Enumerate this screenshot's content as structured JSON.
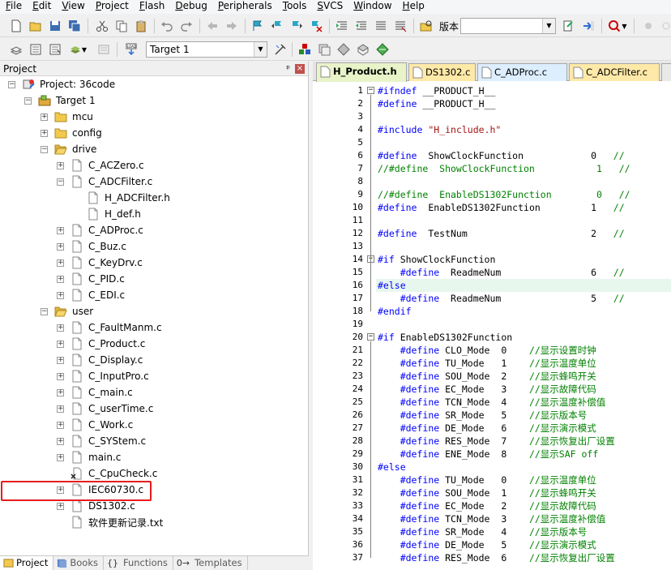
{
  "menu": [
    "File",
    "Edit",
    "View",
    "Project",
    "Flash",
    "Debug",
    "Peripherals",
    "Tools",
    "SVCS",
    "Window",
    "Help"
  ],
  "menu_underline": [
    "F",
    "E",
    "V",
    "P",
    "F",
    "D",
    "P",
    "T",
    "S",
    "W",
    "H"
  ],
  "toolbar": {
    "version_label": "版本",
    "target": "Target 1"
  },
  "project_panel": {
    "title": "Project",
    "pin": "ᵖ",
    "close": "×",
    "tree": [
      {
        "label": "Project: 36code",
        "depth": 0,
        "expander": "minus",
        "icon": "project-icon"
      },
      {
        "label": "Target 1",
        "depth": 1,
        "expander": "minus",
        "icon": "target-icon"
      },
      {
        "label": "mcu",
        "depth": 2,
        "expander": "plus",
        "icon": "folder-icon"
      },
      {
        "label": "config",
        "depth": 2,
        "expander": "plus",
        "icon": "folder-icon"
      },
      {
        "label": "drive",
        "depth": 2,
        "expander": "minus",
        "icon": "folder-open-icon"
      },
      {
        "label": "C_ACZero.c",
        "depth": 3,
        "expander": "plus",
        "icon": "file-icon"
      },
      {
        "label": "C_ADCFilter.c",
        "depth": 3,
        "expander": "minus",
        "icon": "file-icon"
      },
      {
        "label": "H_ADCFilter.h",
        "depth": 4,
        "expander": "none",
        "icon": "file-icon"
      },
      {
        "label": "H_def.h",
        "depth": 4,
        "expander": "none",
        "icon": "file-icon"
      },
      {
        "label": "C_ADProc.c",
        "depth": 3,
        "expander": "plus",
        "icon": "file-icon"
      },
      {
        "label": "C_Buz.c",
        "depth": 3,
        "expander": "plus",
        "icon": "file-icon"
      },
      {
        "label": "C_KeyDrv.c",
        "depth": 3,
        "expander": "plus",
        "icon": "file-icon"
      },
      {
        "label": "C_PID.c",
        "depth": 3,
        "expander": "plus",
        "icon": "file-icon"
      },
      {
        "label": "C_EDI.c",
        "depth": 3,
        "expander": "plus",
        "icon": "file-icon"
      },
      {
        "label": "user",
        "depth": 2,
        "expander": "minus",
        "icon": "folder-open-icon"
      },
      {
        "label": "C_FaultManm.c",
        "depth": 3,
        "expander": "plus",
        "icon": "file-icon"
      },
      {
        "label": "C_Product.c",
        "depth": 3,
        "expander": "plus",
        "icon": "file-icon"
      },
      {
        "label": "C_Display.c",
        "depth": 3,
        "expander": "plus",
        "icon": "file-icon"
      },
      {
        "label": "C_InputPro.c",
        "depth": 3,
        "expander": "plus",
        "icon": "file-icon"
      },
      {
        "label": "C_main.c",
        "depth": 3,
        "expander": "plus",
        "icon": "file-icon"
      },
      {
        "label": "C_userTime.c",
        "depth": 3,
        "expander": "plus",
        "icon": "file-icon"
      },
      {
        "label": "C_Work.c",
        "depth": 3,
        "expander": "plus",
        "icon": "file-icon"
      },
      {
        "label": "C_SYStem.c",
        "depth": 3,
        "expander": "plus",
        "icon": "file-icon"
      },
      {
        "label": "main.c",
        "depth": 3,
        "expander": "plus",
        "icon": "file-icon"
      },
      {
        "label": "C_CpuCheck.c",
        "depth": 3,
        "expander": "none",
        "icon": "file-excluded-icon"
      },
      {
        "label": "IEC60730.c",
        "depth": 3,
        "expander": "plus",
        "icon": "file-icon"
      },
      {
        "label": "DS1302.c",
        "depth": 3,
        "expander": "plus",
        "icon": "file-icon"
      },
      {
        "label": "软件更新记录.txt",
        "depth": 3,
        "expander": "none",
        "icon": "file-icon"
      }
    ],
    "bottom_tabs": [
      {
        "label": "Project",
        "icon": "project-tab-icon"
      },
      {
        "label": "Books",
        "icon": "books-icon"
      },
      {
        "label": "Functions",
        "icon": "{}"
      },
      {
        "label": "Templates",
        "icon": "0→"
      }
    ]
  },
  "editor": {
    "tabs": [
      "H_Product.h",
      "DS1302.c",
      "C_ADProc.c",
      "C_ADCFilter.c"
    ],
    "active_tab": 0,
    "tab_colors": [
      "#e8f3c8",
      "#ffe9a8",
      "#ddeeff",
      "#ffe9a8"
    ],
    "highlight_line": 16,
    "lines": [
      {
        "n": "1",
        "fold": "minus",
        "t": "#ifndef __PRODUCT_H__"
      },
      {
        "n": "2",
        "fold": "",
        "t": "#define __PRODUCT_H__"
      },
      {
        "n": "3",
        "fold": "",
        "t": ""
      },
      {
        "n": "4",
        "fold": "",
        "t": "#include \"H_include.h\""
      },
      {
        "n": "5",
        "fold": "",
        "t": ""
      },
      {
        "n": "6",
        "fold": "",
        "t": "#define  ShowClockFunction            0   //"
      },
      {
        "n": "7",
        "fold": "",
        "t": "//#define  ShowClockFunction           1   //"
      },
      {
        "n": "8",
        "fold": "",
        "t": ""
      },
      {
        "n": "9",
        "fold": "",
        "t": "//#define  EnableDS1302Function        0   //"
      },
      {
        "n": "10",
        "fold": "",
        "t": "#define  EnableDS1302Function         1   //"
      },
      {
        "n": "11",
        "fold": "",
        "t": ""
      },
      {
        "n": "12",
        "fold": "",
        "t": "#define  TestNum                      2   //"
      },
      {
        "n": "13",
        "fold": "",
        "t": ""
      },
      {
        "n": "14",
        "fold": "minus",
        "t": "#if ShowClockFunction"
      },
      {
        "n": "15",
        "fold": "",
        "t": "    #define  ReadmeNum                6   //"
      },
      {
        "n": "16",
        "fold": "",
        "t": "#else"
      },
      {
        "n": "17",
        "fold": "",
        "t": "    #define  ReadmeNum                5   //"
      },
      {
        "n": "18",
        "fold": "",
        "t": "#endif"
      },
      {
        "n": "19",
        "fold": "",
        "t": ""
      },
      {
        "n": "20",
        "fold": "minus",
        "t": "#if EnableDS1302Function"
      },
      {
        "n": "21",
        "fold": "",
        "t": "    #define CLO_Mode  0    //显示设置时钟"
      },
      {
        "n": "22",
        "fold": "",
        "t": "    #define TU_Mode   1    //显示温度单位"
      },
      {
        "n": "23",
        "fold": "",
        "t": "    #define SOU_Mode  2    //显示蜂鸣开关"
      },
      {
        "n": "24",
        "fold": "",
        "t": "    #define EC_Mode   3    //显示故障代码"
      },
      {
        "n": "25",
        "fold": "",
        "t": "    #define TCN_Mode  4    //显示温度补偿值"
      },
      {
        "n": "26",
        "fold": "",
        "t": "    #define SR_Mode   5    //显示版本号"
      },
      {
        "n": "27",
        "fold": "",
        "t": "    #define DE_Mode   6    //显示演示模式"
      },
      {
        "n": "28",
        "fold": "",
        "t": "    #define RES_Mode  7    //显示恢复出厂设置"
      },
      {
        "n": "29",
        "fold": "",
        "t": "    #define ENE_Mode  8    //显示SAF off"
      },
      {
        "n": "30",
        "fold": "",
        "t": "#else"
      },
      {
        "n": "31",
        "fold": "",
        "t": "    #define TU_Mode   0    //显示温度单位"
      },
      {
        "n": "32",
        "fold": "",
        "t": "    #define SOU_Mode  1    //显示蜂鸣开关"
      },
      {
        "n": "33",
        "fold": "",
        "t": "    #define EC_Mode   2    //显示故障代码"
      },
      {
        "n": "34",
        "fold": "",
        "t": "    #define TCN_Mode  3    //显示温度补偿值"
      },
      {
        "n": "35",
        "fold": "",
        "t": "    #define SR_Mode   4    //显示版本号"
      },
      {
        "n": "36",
        "fold": "",
        "t": "    #define DE_Mode   5    //显示演示模式"
      },
      {
        "n": "37",
        "fold": "",
        "t": "    #define RES_Mode  6    //显示恢复出厂设置"
      }
    ]
  }
}
